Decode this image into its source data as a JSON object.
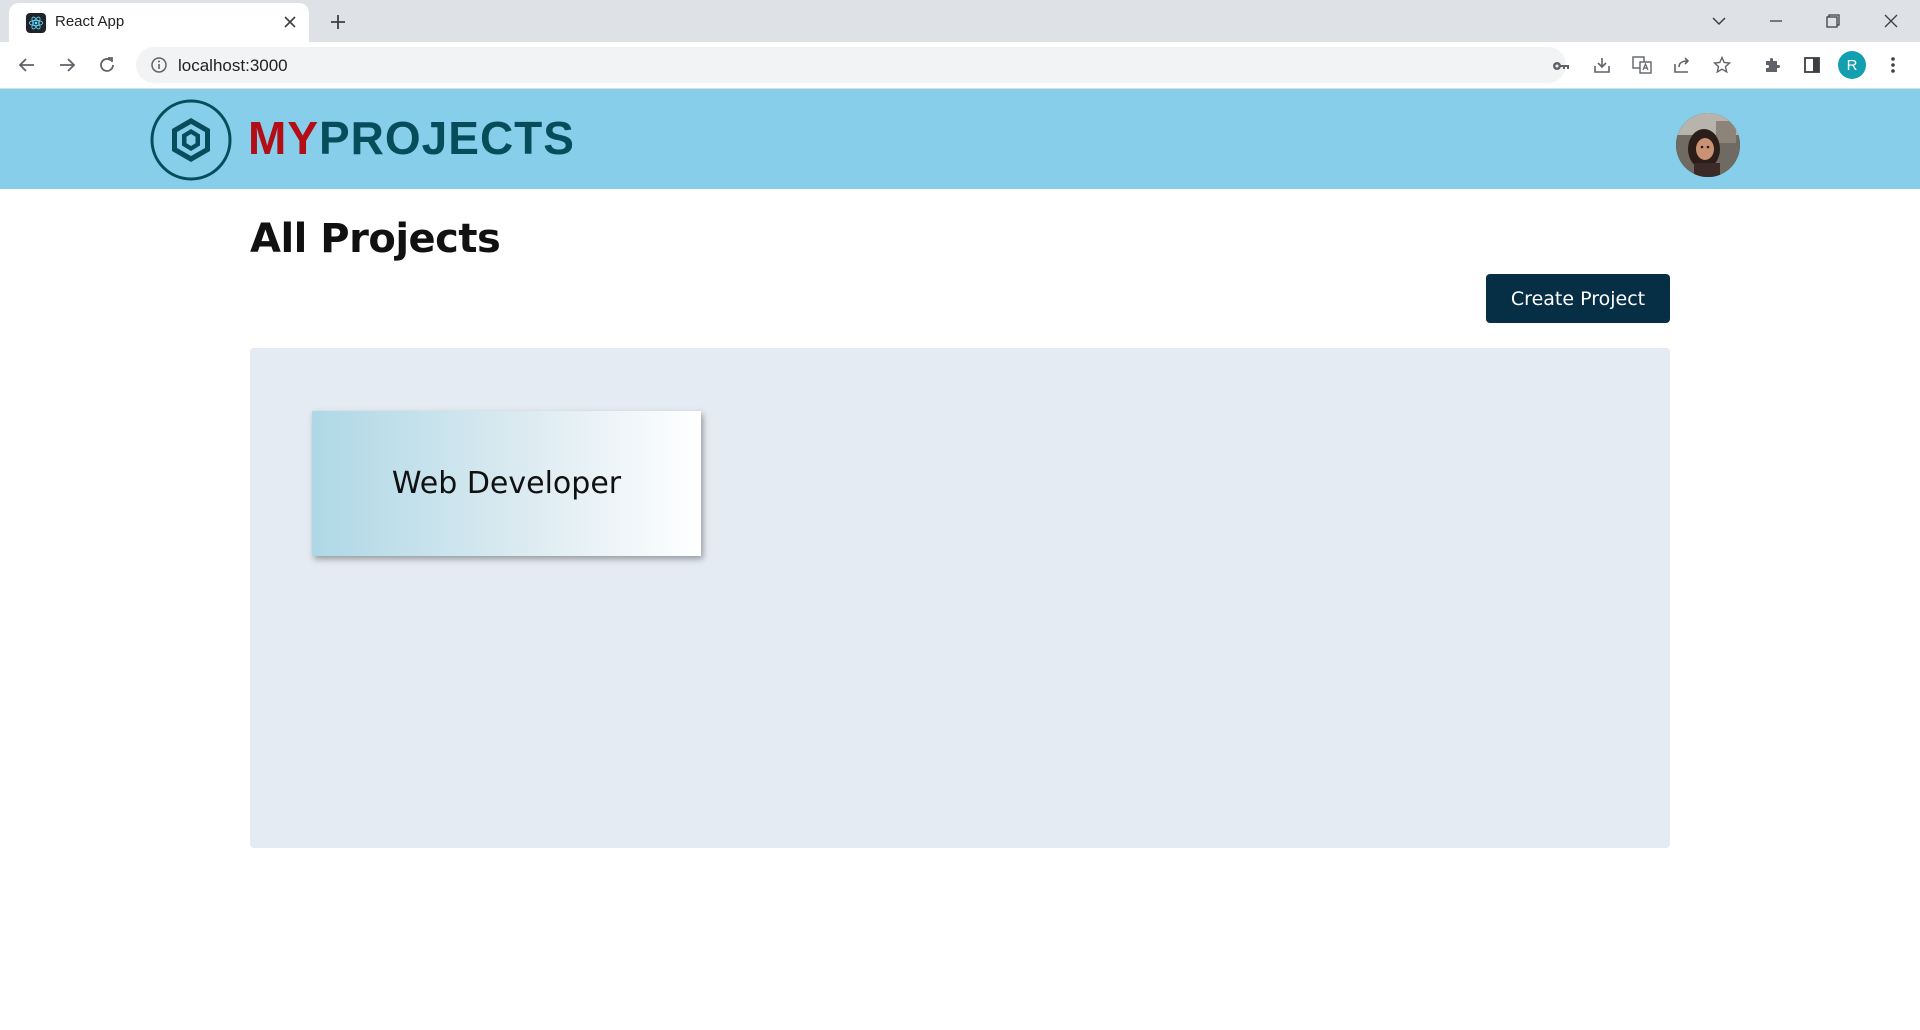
{
  "browser": {
    "tab_title": "React App",
    "url": "localhost:3000",
    "profile_initial": "R"
  },
  "header": {
    "logo_my": "MY",
    "logo_projects": "PROJECTS"
  },
  "main": {
    "title": "All Projects",
    "create_button_label": "Create Project",
    "projects": [
      {
        "title": "Web Developer"
      }
    ]
  },
  "colors": {
    "header_bg": "#87ceeb",
    "logo_red": "#b30d16",
    "logo_teal": "#074c5a",
    "button_bg": "#062e45",
    "panel_bg": "#e4ebf2"
  }
}
